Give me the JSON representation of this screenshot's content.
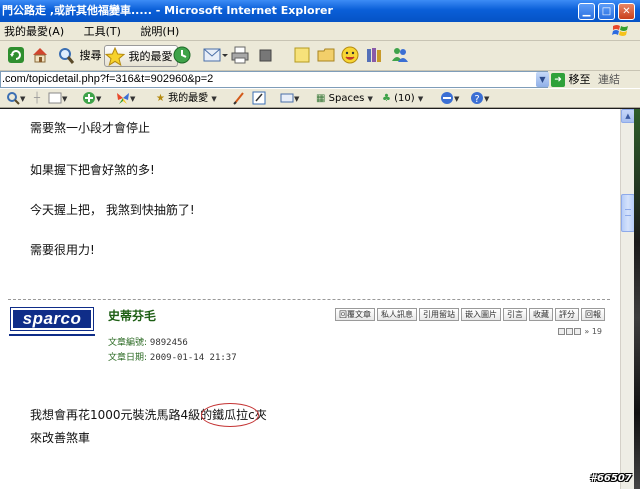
{
  "window": {
    "title": "門公路走 ,或許其他福變車..... - Microsoft Internet Explorer"
  },
  "menu": [
    "我的最愛(A)",
    "工具(T)",
    "說明(H)"
  ],
  "toolbar": {
    "search_label": "搜尋",
    "favorites_label": "我的最愛"
  },
  "address": {
    "url": ".com/topicdetail.php?f=316&t=902960&p=2",
    "go_label": "移至",
    "links_label": "連結"
  },
  "linkbar": {
    "favorites_label": "我的最愛",
    "spaces_label": "Spaces",
    "count_label": "(10)"
  },
  "previous_post": {
    "lines": [
      "需要煞一小段才會停止",
      "如果握下把會好煞的多!",
      "今天握上把， 我煞到快抽筋了!",
      "需要很用力!"
    ]
  },
  "post": {
    "logo_text": "sparco",
    "username": "史蒂芬毛",
    "number_label": "文章編號:",
    "number_value": "9892456",
    "date_label": "文章日期:",
    "date_value": "2009-01-14 21:37",
    "actions": [
      "回覆文章",
      "私人訊息",
      "引用留站",
      "嵌入圖片",
      "引言",
      "收藏",
      "評分",
      "回報"
    ],
    "pager_text": "» 19",
    "body": [
      "我想會再花1000元裝洗馬路4級的鐵瓜拉c夾",
      "來改善煞車"
    ]
  },
  "watermark": "#66507"
}
